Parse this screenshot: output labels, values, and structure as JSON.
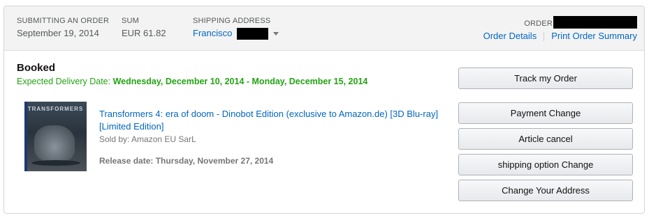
{
  "header": {
    "submitted_label": "SUBMITTING AN ORDER",
    "submitted_value": "September 19, 2014",
    "sum_label": "SUM",
    "sum_value": "EUR 61.82",
    "shipping_label": "SHIPPING ADDRESS",
    "shipping_name": "Francisco",
    "order_label": "ORDER",
    "order_details": "Order Details",
    "print_summary": "Print Order Summary"
  },
  "shipment": {
    "status": "Booked",
    "delivery_prefix": "Expected Delivery Date:",
    "delivery_range": "Wednesday, December 10, 2014 - Monday, December 15, 2014"
  },
  "item": {
    "title": "Transformers 4: era of doom - Dinobot Edition (exclusive to Amazon.de) [3D Blu-ray] [Limited Edition]",
    "seller": "Sold by: Amazon EU SarL",
    "release_prefix": "Release date:",
    "release_date": "Thursday, November 27, 2014",
    "image_text": "TRANSFORMERS"
  },
  "actions": {
    "track": "Track my Order",
    "payment": "Payment Change",
    "cancel": "Article cancel",
    "shipping_option": "shipping option Change",
    "address": "Change Your Address"
  },
  "colors": {
    "link": "#0066c0",
    "delivery": "#24a314"
  }
}
